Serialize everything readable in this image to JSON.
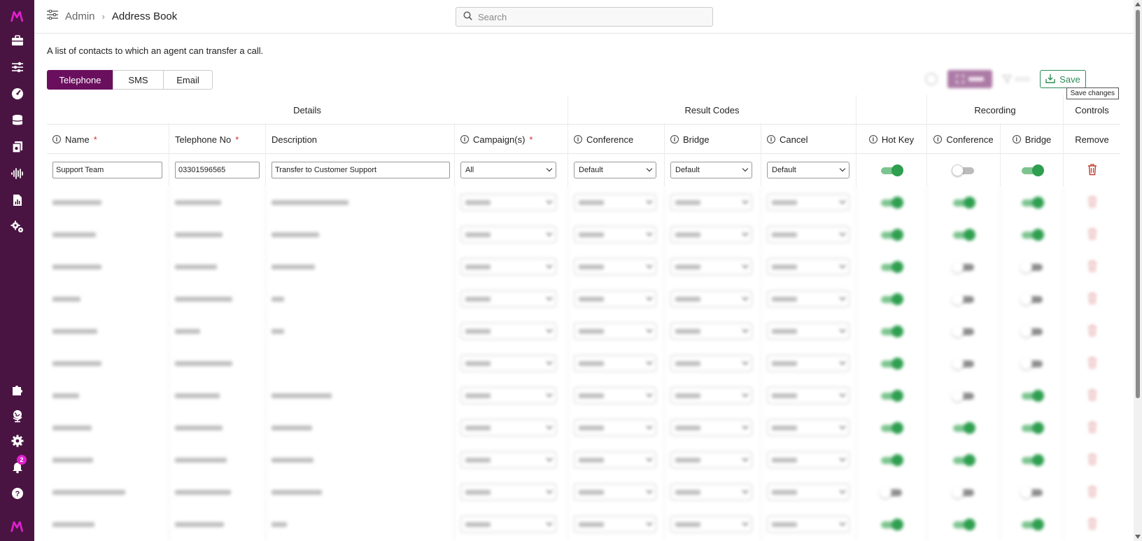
{
  "header": {
    "breadcrumb_parent": "Admin",
    "breadcrumb_current": "Address Book",
    "search_placeholder": "Search"
  },
  "nav": {
    "icons": [
      "briefcase-icon",
      "sliders-icon",
      "dashboard-icon",
      "database-icon",
      "documents-icon",
      "waveform-icon",
      "report-icon",
      "cogs-icon",
      "puzzle-icon",
      "globe-icon",
      "settings-icon",
      "bell-icon",
      "help-icon"
    ],
    "notification_count": "2"
  },
  "page": {
    "description": "A list of contacts to which an agent can transfer a call."
  },
  "tabs": [
    "Telephone",
    "SMS",
    "Email"
  ],
  "toolbar": {
    "save_label": "Save",
    "save_tooltip": "Save changes"
  },
  "table": {
    "groups": {
      "details": "Details",
      "result_codes": "Result Codes",
      "recording": "Recording",
      "controls": "Controls"
    },
    "columns": {
      "name": "Name",
      "telephone": "Telephone No",
      "description": "Description",
      "campaigns": "Campaign(s)",
      "conference": "Conference",
      "bridge": "Bridge",
      "cancel": "Cancel",
      "hot_key": "Hot Key",
      "rec_conference": "Conference",
      "rec_bridge": "Bridge",
      "remove": "Remove"
    },
    "first_row": {
      "name": "Support Team",
      "telephone": "03301596565",
      "description": "Transfer to Customer Support",
      "campaign": "All",
      "conference": "Default",
      "bridge": "Default",
      "cancel": "Default",
      "hot_key": true,
      "rec_conference": false,
      "rec_bridge": true
    },
    "obscured_rows": {
      "count": 11,
      "hot_key": [
        true,
        true,
        true,
        true,
        true,
        true,
        true,
        true,
        true,
        false,
        true
      ],
      "rec_conference": [
        true,
        true,
        false,
        false,
        false,
        false,
        false,
        true,
        true,
        false,
        true
      ],
      "rec_bridge": [
        true,
        true,
        false,
        false,
        false,
        false,
        true,
        true,
        true,
        false,
        true
      ]
    }
  },
  "colors": {
    "rail": "#4a1442",
    "accent": "#6a0f5e",
    "toggle_on": "#2e9e4f",
    "save": "#2e8b57",
    "required": "#d32f2f",
    "trash": "#c0392b"
  }
}
